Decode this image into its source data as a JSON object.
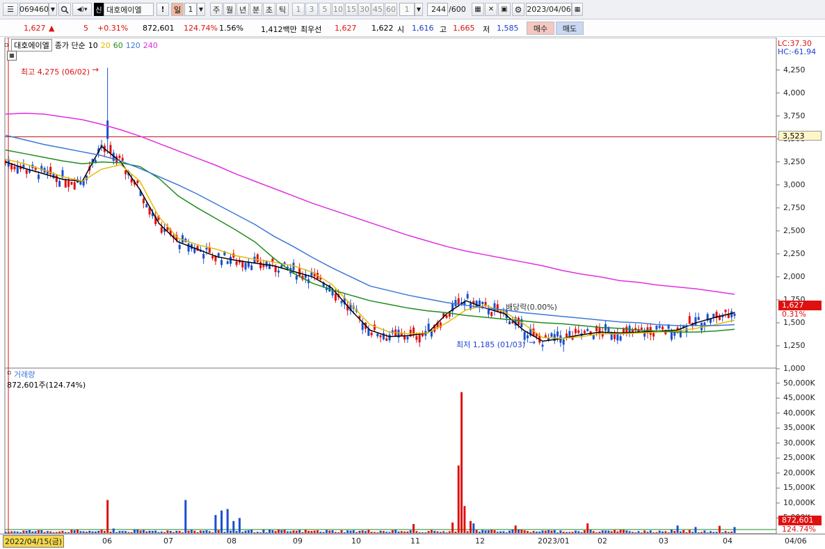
{
  "toolbar": {
    "code": "069460",
    "stock_badge": "신",
    "stock_name": "대호에이엘",
    "alert_icon": "!",
    "period_active": "일",
    "period_value": "1",
    "periods": [
      "주",
      "월",
      "년",
      "분",
      "초",
      "틱"
    ],
    "intervals": [
      "1",
      "3",
      "5",
      "10",
      "15",
      "30",
      "45",
      "60"
    ],
    "interval_custom": "1",
    "count_current": "244",
    "count_max": "/600",
    "date": "2023/04/06"
  },
  "quote": {
    "price": "1,627",
    "change": "5",
    "change_pct": "+0.31%",
    "volume": "872,601",
    "volume_ratio": "124.74%",
    "turnover": "1.56%",
    "amount": "1,412백만",
    "best_ask_label": "최우선",
    "best_ask": "1,627",
    "best_bid": "1,622",
    "open_label": "시",
    "open": "1,616",
    "high_label": "고",
    "high": "1,665",
    "low_label": "저",
    "low": "1,585",
    "buy_label": "매수",
    "sell_label": "매도"
  },
  "price_legend": {
    "name": "대호에이엘",
    "desc": "종가 단순",
    "ma": [
      "10",
      "20",
      "60",
      "120",
      "240"
    ]
  },
  "lc_label": "LC:37.30",
  "hc_label": "HC:-61.94",
  "price_axis": [
    "4,250",
    "4,000",
    "3,750",
    "3,500",
    "3,250",
    "3,000",
    "2,750",
    "2,500",
    "2,250",
    "2,000",
    "1,750",
    "1,500",
    "1,250",
    "1,000"
  ],
  "ref_line_value": "3,523",
  "current_price_tag": "1,627",
  "current_change_tag": "0.31%",
  "annotations": {
    "high": "최고 4,275 (06/02)",
    "low": "최저 1,185 (01/03)",
    "dividend": "배당락(0.00%)"
  },
  "volume_legend": {
    "name": "거래량",
    "value": "872,601주(124.74%)"
  },
  "volume_axis": [
    "50,000K",
    "45,000K",
    "40,000K",
    "35,000K",
    "30,000K",
    "25,000K",
    "20,000K",
    "15,000K",
    "10,000K",
    "5,000K"
  ],
  "volume_tag": "872,601",
  "volume_ratio_tag": "124.74%",
  "date_axis": {
    "start": "2022/04/15(금)",
    "months": [
      "06",
      "07",
      "08",
      "09",
      "10",
      "11",
      "12",
      "2023/01",
      "02",
      "03",
      "04"
    ],
    "end": "04/06"
  },
  "chart_data": {
    "type": "candlestick",
    "ylim": [
      1000,
      4300
    ],
    "moving_averages": [
      {
        "name": "10",
        "color": "#000000",
        "values": [
          3250,
          3180,
          3120,
          3060,
          3040,
          3420,
          3250,
          2950,
          2580,
          2380,
          2300,
          2220,
          2180,
          2150,
          2120,
          2060,
          2000,
          1880,
          1640,
          1420,
          1350,
          1360,
          1390,
          1600,
          1740,
          1660,
          1600,
          1420,
          1300,
          1330,
          1370,
          1400,
          1390,
          1400,
          1410,
          1420,
          1500,
          1560,
          1610
        ]
      },
      {
        "name": "20",
        "color": "#e6b800",
        "values": [
          3280,
          3230,
          3160,
          3090,
          3040,
          3170,
          3220,
          3040,
          2650,
          2420,
          2350,
          2300,
          2230,
          2190,
          2160,
          2120,
          2050,
          1920,
          1700,
          1480,
          1400,
          1380,
          1390,
          1500,
          1640,
          1690,
          1620,
          1490,
          1340,
          1330,
          1350,
          1380,
          1380,
          1390,
          1400,
          1410,
          1440,
          1480,
          1530
        ]
      },
      {
        "name": "60",
        "color": "#1f8b1f",
        "values": [
          3380,
          3340,
          3300,
          3260,
          3230,
          3250,
          3240,
          3200,
          3070,
          2880,
          2750,
          2630,
          2510,
          2380,
          2200,
          2040,
          1930,
          1860,
          1800,
          1740,
          1700,
          1660,
          1630,
          1610,
          1580,
          1560,
          1540,
          1520,
          1500,
          1490,
          1470,
          1450,
          1440,
          1420,
          1410,
          1400,
          1400,
          1410,
          1430
        ]
      },
      {
        "name": "120",
        "color": "#3a78d8",
        "values": [
          3540,
          3490,
          3440,
          3400,
          3360,
          3320,
          3260,
          3180,
          3090,
          3000,
          2900,
          2790,
          2680,
          2570,
          2440,
          2330,
          2210,
          2100,
          2000,
          1900,
          1850,
          1800,
          1760,
          1720,
          1690,
          1660,
          1640,
          1610,
          1590,
          1570,
          1550,
          1530,
          1510,
          1500,
          1480,
          1470,
          1470,
          1470,
          1480
        ]
      },
      {
        "name": "240",
        "color": "#e02ee0",
        "values": [
          3770,
          3780,
          3770,
          3740,
          3710,
          3660,
          3600,
          3530,
          3450,
          3370,
          3290,
          3210,
          3120,
          3040,
          2960,
          2880,
          2800,
          2730,
          2660,
          2590,
          2520,
          2450,
          2390,
          2330,
          2280,
          2240,
          2200,
          2160,
          2120,
          2070,
          2030,
          2000,
          1960,
          1940,
          1910,
          1890,
          1870,
          1840,
          1810
        ]
      }
    ],
    "x_months": [
      "2022/04",
      "06",
      "07",
      "08",
      "09",
      "10",
      "11",
      "12",
      "2023/01",
      "02",
      "03",
      "04"
    ],
    "volume_peaks_k": {
      "2022-06-02": 11000,
      "2022-07-08": 11000,
      "2022-11-15": 47000,
      "2022-11-14": 22500,
      "2023-04-06": 872.601
    }
  }
}
